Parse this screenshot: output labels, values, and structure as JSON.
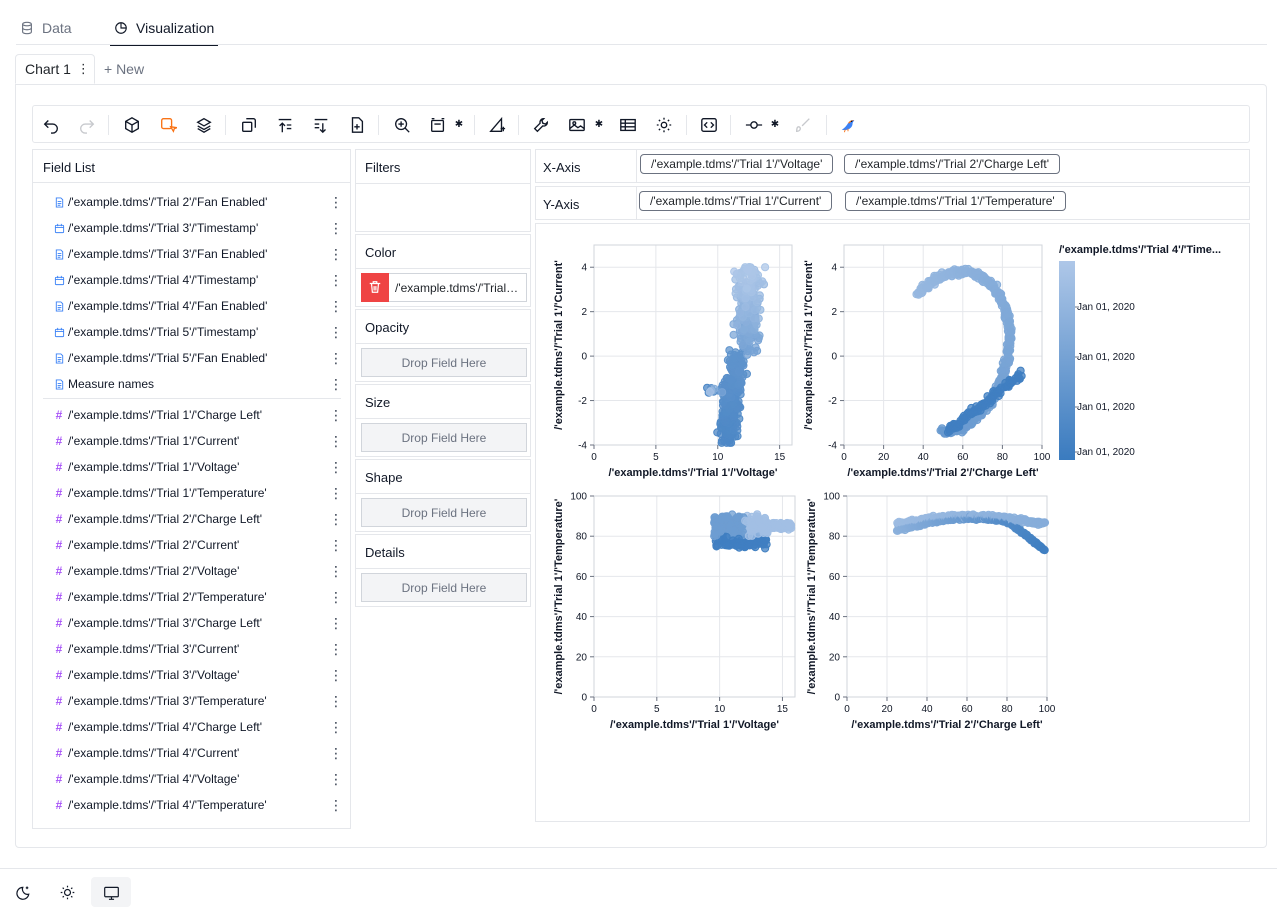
{
  "top_tabs": [
    {
      "label": "Data",
      "icon": "database-icon"
    },
    {
      "label": "Visualization",
      "icon": "chart-icon"
    }
  ],
  "chart_tabs": {
    "active": "Chart 1",
    "new": "+ New"
  },
  "field_list": {
    "title": "Field List",
    "dimensions": [
      {
        "label": "/'example.tdms'/'Trial 2'/'Fan Enabled'",
        "type": "text"
      },
      {
        "label": "/'example.tdms'/'Trial 3'/'Timestamp'",
        "type": "date"
      },
      {
        "label": "/'example.tdms'/'Trial 3'/'Fan Enabled'",
        "type": "text"
      },
      {
        "label": "/'example.tdms'/'Trial 4'/'Timestamp'",
        "type": "date"
      },
      {
        "label": "/'example.tdms'/'Trial 4'/'Fan Enabled'",
        "type": "text"
      },
      {
        "label": "/'example.tdms'/'Trial 5'/'Timestamp'",
        "type": "date"
      },
      {
        "label": "/'example.tdms'/'Trial 5'/'Fan Enabled'",
        "type": "text"
      },
      {
        "label": "Measure names",
        "type": "text"
      }
    ],
    "measures": [
      "/'example.tdms'/'Trial 1'/'Charge Left'",
      "/'example.tdms'/'Trial 1'/'Current'",
      "/'example.tdms'/'Trial 1'/'Voltage'",
      "/'example.tdms'/'Trial 1'/'Temperature'",
      "/'example.tdms'/'Trial 2'/'Charge Left'",
      "/'example.tdms'/'Trial 2'/'Current'",
      "/'example.tdms'/'Trial 2'/'Voltage'",
      "/'example.tdms'/'Trial 2'/'Temperature'",
      "/'example.tdms'/'Trial 3'/'Charge Left'",
      "/'example.tdms'/'Trial 3'/'Current'",
      "/'example.tdms'/'Trial 3'/'Voltage'",
      "/'example.tdms'/'Trial 3'/'Temperature'",
      "/'example.tdms'/'Trial 4'/'Charge Left'",
      "/'example.tdms'/'Trial 4'/'Current'",
      "/'example.tdms'/'Trial 4'/'Voltage'",
      "/'example.tdms'/'Trial 4'/'Temperature'"
    ]
  },
  "encodings": {
    "filters": "Filters",
    "color": "Color",
    "color_field": "/'example.tdms'/'Trial 4'/'Timestamp'",
    "opacity": "Opacity",
    "size": "Size",
    "shape": "Shape",
    "details": "Details",
    "drop_placeholder": "Drop Field Here"
  },
  "axes": {
    "x_label": "X-Axis",
    "x_fields": [
      "/'example.tdms'/'Trial 1'/'Voltage'",
      "/'example.tdms'/'Trial 2'/'Charge Left'"
    ],
    "y_label": "Y-Axis",
    "y_fields": [
      "/'example.tdms'/'Trial 1'/'Current'",
      "/'example.tdms'/'Trial 1'/'Temperature'"
    ]
  },
  "colors": {
    "accent": "#f97316",
    "delete": "#ef4444",
    "point_light": "#aec7e8",
    "point_dark": "#3a7bbf"
  },
  "chart_data": {
    "type": "scatter",
    "facets": [
      {
        "x_field": "/'example.tdms'/'Trial 1'/'Voltage'",
        "y_field": "/'example.tdms'/'Trial 1'/'Current'",
        "xlim": [
          0,
          16
        ],
        "ylim": [
          -4,
          5
        ],
        "xticks": [
          0,
          5,
          10,
          15
        ],
        "yticks": [
          -4,
          -2,
          0,
          2,
          4
        ]
      },
      {
        "x_field": "/'example.tdms'/'Trial 2'/'Charge Left'",
        "y_field": "/'example.tdms'/'Trial 1'/'Current'",
        "xlim": [
          0,
          100
        ],
        "ylim": [
          -4,
          5
        ],
        "xticks": [
          0,
          20,
          40,
          60,
          80,
          100
        ],
        "yticks": [
          -4,
          -2,
          0,
          2,
          4
        ]
      },
      {
        "x_field": "/'example.tdms'/'Trial 1'/'Voltage'",
        "y_field": "/'example.tdms'/'Trial 1'/'Temperature'",
        "xlim": [
          0,
          16
        ],
        "ylim": [
          0,
          100
        ],
        "xticks": [
          0,
          5,
          10,
          15
        ],
        "yticks": [
          0,
          20,
          40,
          60,
          80,
          100
        ]
      },
      {
        "x_field": "/'example.tdms'/'Trial 2'/'Charge Left'",
        "y_field": "/'example.tdms'/'Trial 1'/'Temperature'",
        "xlim": [
          0,
          100
        ],
        "ylim": [
          0,
          100
        ],
        "xticks": [
          0,
          20,
          40,
          60,
          80,
          100
        ],
        "yticks": [
          0,
          20,
          40,
          60,
          80,
          100
        ]
      }
    ],
    "legend": {
      "title": "/'example.tdms'/'Trial 4'/'Time...",
      "labels": [
        "Jan 01, 2020",
        "Jan 01, 2020",
        "Jan 01, 2020",
        "Jan 01, 2020"
      ],
      "position": "right"
    }
  },
  "theme_buttons": [
    "moon-icon",
    "sun-icon",
    "monitor-icon"
  ]
}
